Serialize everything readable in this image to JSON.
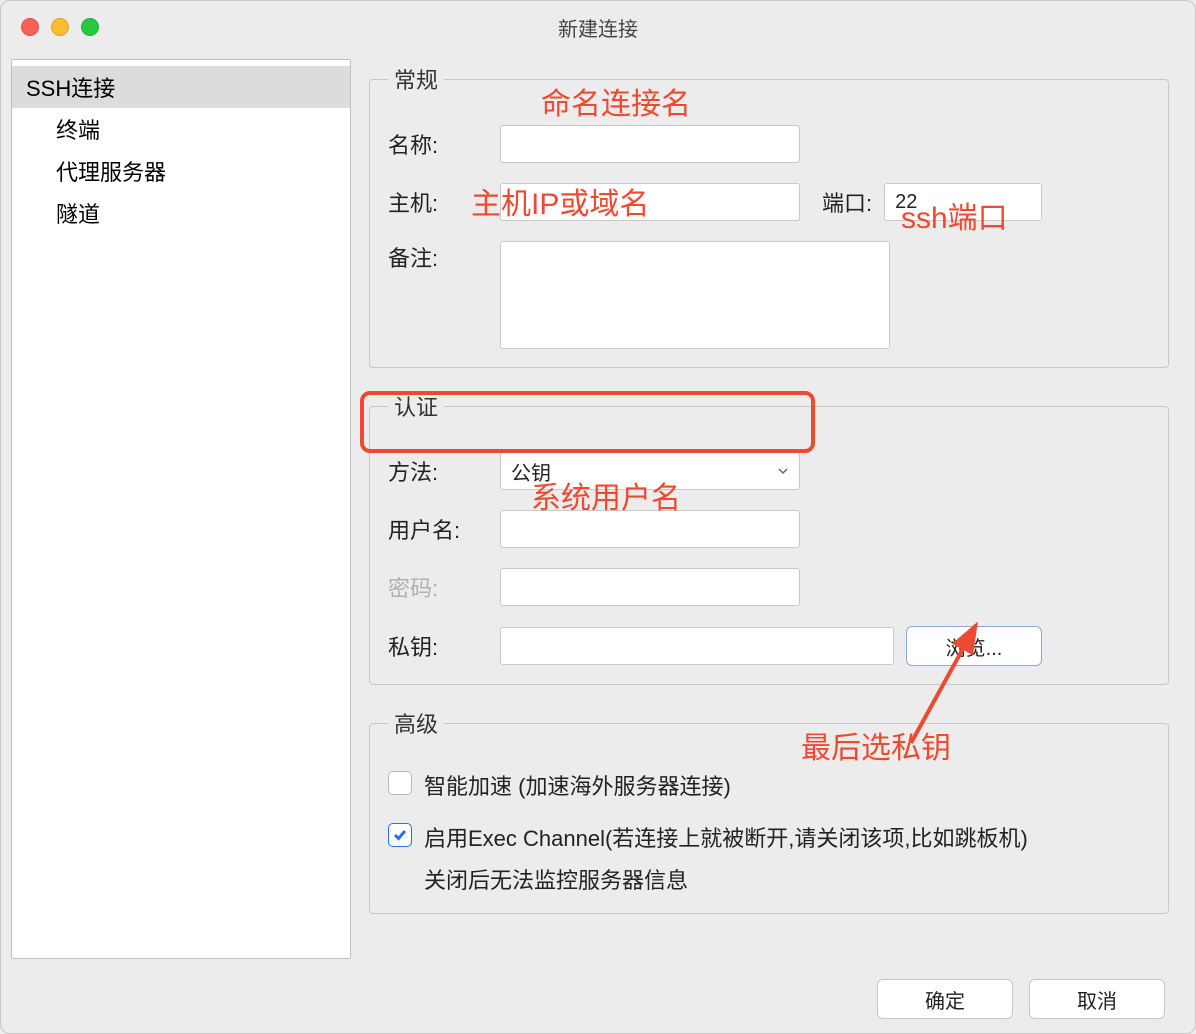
{
  "window": {
    "title": "新建连接"
  },
  "sidebar": {
    "items": [
      {
        "label": "SSH连接",
        "selected": true,
        "child": false
      },
      {
        "label": "终端",
        "selected": false,
        "child": true
      },
      {
        "label": "代理服务器",
        "selected": false,
        "child": true
      },
      {
        "label": "隧道",
        "selected": false,
        "child": true
      }
    ]
  },
  "general": {
    "legend": "常规",
    "name_label": "名称:",
    "name_value": "",
    "host_label": "主机:",
    "host_value": "",
    "port_label": "端口:",
    "port_value": "22",
    "notes_label": "备注:",
    "notes_value": ""
  },
  "auth": {
    "legend": "认证",
    "method_label": "方法:",
    "method_value": "公钥",
    "user_label": "用户名:",
    "user_value": "",
    "pass_label": "密码:",
    "pass_value": "",
    "pk_label": "私钥:",
    "pk_value": "",
    "browse_label": "浏览..."
  },
  "advanced": {
    "legend": "高级",
    "smart_accel_checked": false,
    "smart_accel_label": "智能加速 (加速海外服务器连接)",
    "exec_channel_checked": true,
    "exec_channel_label": "启用Exec Channel(若连接上就被断开,请关闭该项,比如跳板机)",
    "exec_channel_note": "关闭后无法监控服务器信息"
  },
  "footer": {
    "ok_label": "确定",
    "cancel_label": "取消"
  },
  "annotations": {
    "a1": "命名连接名",
    "a2": "主机IP或域名",
    "a3": "ssh端口",
    "a4": "系统用户名",
    "a5": "最后选私钥"
  }
}
